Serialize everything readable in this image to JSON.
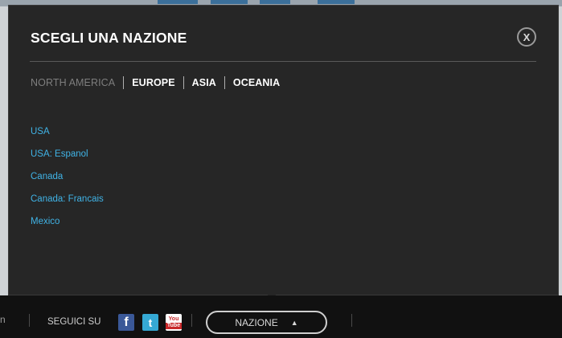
{
  "modal": {
    "title": "SCEGLI UNA NAZIONE",
    "close_label": "X"
  },
  "regions": {
    "tabs": [
      {
        "label": "NORTH AMERICA",
        "active": true
      },
      {
        "label": "EUROPE",
        "active": false
      },
      {
        "label": "ASIA",
        "active": false
      },
      {
        "label": "OCEANIA",
        "active": false
      }
    ]
  },
  "countries": {
    "items": [
      {
        "label": "USA"
      },
      {
        "label": "USA: Espanol"
      },
      {
        "label": "Canada"
      },
      {
        "label": "Canada: Francais"
      },
      {
        "label": "Mexico"
      }
    ]
  },
  "footer": {
    "edge_text": "n",
    "follow_label": "SEGUICI SU",
    "social": {
      "facebook_glyph": "f",
      "twitter_glyph": "t",
      "youtube_top": "You",
      "youtube_bottom": "Tube"
    },
    "country_button_label": "NAZIONE",
    "country_button_caret": "▲"
  },
  "colors": {
    "modal_bg": "#262626",
    "link": "#40b3e6",
    "footer_bg": "#111111",
    "inactive_tab": "#7e7e7e"
  },
  "icons": [
    "close-icon",
    "facebook-icon",
    "twitter-icon",
    "youtube-icon",
    "caret-up-icon"
  ]
}
